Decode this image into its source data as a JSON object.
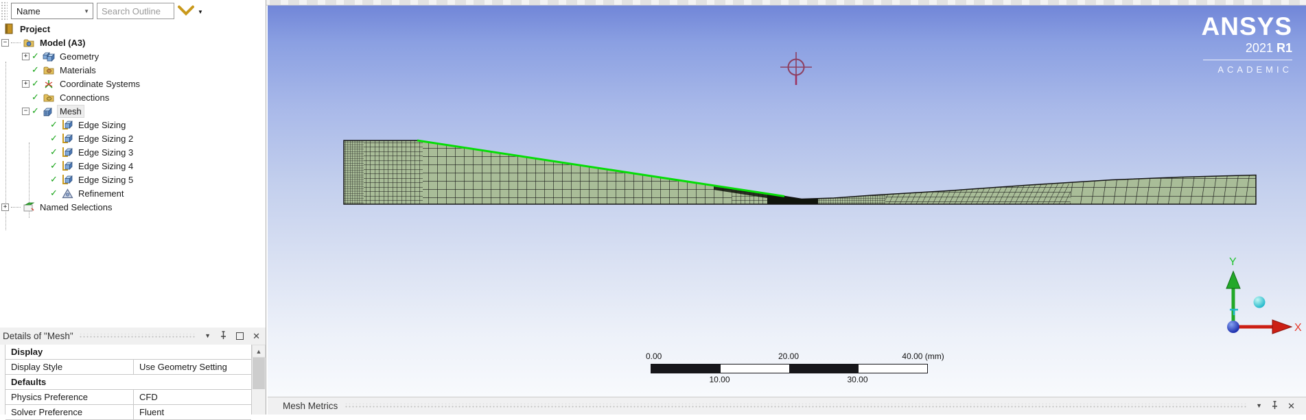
{
  "outline_toolbar": {
    "filter_label": "Name",
    "search_placeholder": "Search Outline",
    "dropdown_icon": "chevron-down-icon",
    "more_icon": "caret-down-icon"
  },
  "tree": {
    "items": [
      {
        "label": "Project",
        "icon": "project",
        "bold": true,
        "indent": 4
      },
      {
        "label": "Model (A3)",
        "icon": "model",
        "bold": true,
        "indent": 2,
        "expand": "minus",
        "stub": true
      },
      {
        "label": "Geometry",
        "icon": "geometry",
        "indent": 32,
        "expand": "plus",
        "check": true
      },
      {
        "label": "Materials",
        "icon": "materials",
        "indent": 32,
        "spacer": true,
        "check": true
      },
      {
        "label": "Coordinate Systems",
        "icon": "coordinate-systems",
        "indent": 32,
        "expand": "plus",
        "check": true
      },
      {
        "label": "Connections",
        "icon": "connections",
        "indent": 32,
        "spacer": true,
        "check": true
      },
      {
        "label": "Mesh",
        "icon": "mesh",
        "indent": 32,
        "expand": "minus",
        "check": true,
        "selected": true
      },
      {
        "label": "Edge Sizing",
        "icon": "edge-sizing",
        "indent": 59,
        "spacer": true,
        "check": true
      },
      {
        "label": "Edge Sizing 2",
        "icon": "edge-sizing",
        "indent": 59,
        "spacer": true,
        "check": true
      },
      {
        "label": "Edge Sizing 3",
        "icon": "edge-sizing",
        "indent": 59,
        "spacer": true,
        "check": true
      },
      {
        "label": "Edge Sizing 4",
        "icon": "edge-sizing",
        "indent": 59,
        "spacer": true,
        "check": true
      },
      {
        "label": "Edge Sizing 5",
        "icon": "edge-sizing",
        "indent": 59,
        "spacer": true,
        "check": true
      },
      {
        "label": "Refinement",
        "icon": "refinement",
        "indent": 59,
        "spacer": true,
        "check": true
      },
      {
        "label": "Named Selections",
        "icon": "named-selections",
        "indent": 2,
        "expand": "plus",
        "stub": true
      }
    ]
  },
  "details": {
    "title": "Details of \"Mesh\"",
    "window_icons": [
      "dropdown-icon",
      "pin-icon",
      "maximize-icon",
      "close-icon"
    ],
    "rows": [
      {
        "type": "category",
        "label": "Display"
      },
      {
        "type": "row",
        "label": "Display Style",
        "value": "Use Geometry Setting"
      },
      {
        "type": "category",
        "label": "Defaults"
      },
      {
        "type": "row",
        "label": "Physics Preference",
        "value": "CFD"
      },
      {
        "type": "row",
        "label": "Solver Preference",
        "value": "Fluent"
      }
    ]
  },
  "viewport": {
    "logo": {
      "title": "ANSYS",
      "version_regular": "2021",
      "version_bold": "R1",
      "subtitle": "ACADEMIC"
    },
    "ruler": {
      "unit": "(mm)",
      "ticks_top": [
        "0.00",
        "20.00",
        "40.00"
      ],
      "ticks_bottom": [
        "10.00",
        "30.00"
      ],
      "segment_colors": [
        "#16161a",
        "#ffffff",
        "#16161a",
        "#ffffff"
      ]
    },
    "triad": {
      "x_label": "X",
      "y_label": "Y",
      "x_color": "#e8392b",
      "y_color": "#1fc32c"
    },
    "metrics_bar": {
      "title": "Mesh Metrics",
      "window_icons": [
        "dropdown-icon",
        "pin-icon",
        "close-icon"
      ]
    }
  },
  "colors": {
    "accent_gold": "#c9991c",
    "check_green": "#15a315",
    "mesh_fill": "#a9bd98",
    "mesh_line": "#141414",
    "mesh_highlight_edge": "#06dd06",
    "viewport_top": "#7186d8",
    "viewport_bottom": "#f8fafd",
    "crosshair": "#8d3f60"
  }
}
